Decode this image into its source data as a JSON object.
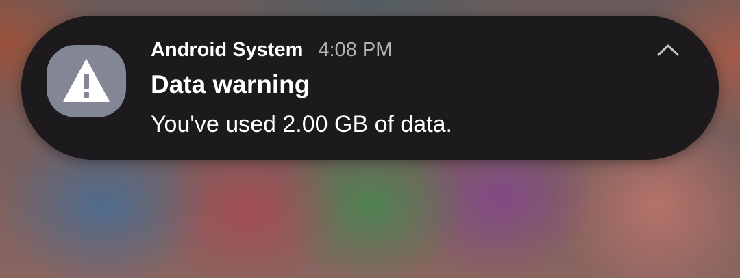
{
  "notification": {
    "app_name": "Android System",
    "time": "4:08 PM",
    "title": "Data warning",
    "body": "You've used 2.00 GB of data.",
    "app_icon": "warning-triangle-icon",
    "collapse_icon": "chevron-up-icon"
  },
  "colors": {
    "card_background": "#1c1a1c",
    "icon_background": "#838795",
    "primary_text": "#ffffff",
    "secondary_text": "#b3b1b4"
  }
}
